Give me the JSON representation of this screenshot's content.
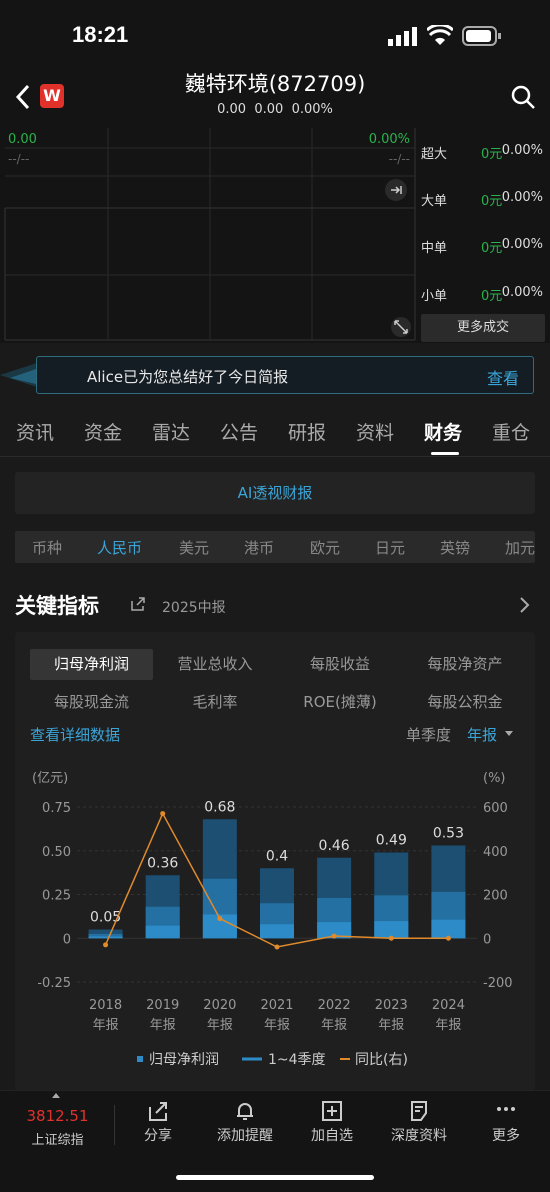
{
  "status": {
    "time": "18:21"
  },
  "header": {
    "title": "巍特环境(872709)",
    "sub1": "0.00",
    "sub2": "0.00",
    "sub3": "0.00%",
    "logo": "W"
  },
  "mini": {
    "left_val": "0.00",
    "right_val": "0.00%",
    "left_dash": "--/--",
    "right_dash": "--/--"
  },
  "flows": [
    {
      "label": "超大",
      "amt": "0元",
      "pct": "0.00%"
    },
    {
      "label": "大单",
      "amt": "0元",
      "pct": "0.00%"
    },
    {
      "label": "中单",
      "amt": "0元",
      "pct": "0.00%"
    },
    {
      "label": "小单",
      "amt": "0元",
      "pct": "0.00%"
    }
  ],
  "more_deals": "更多成交",
  "banner": {
    "text": "Alice已为您总结好了今日简报",
    "action": "查看"
  },
  "tabs": [
    "资讯",
    "资金",
    "雷达",
    "公告",
    "研报",
    "资料",
    "财务",
    "重仓"
  ],
  "ai_button": "AI透视财报",
  "currencies": [
    "币种",
    "人民币",
    "美元",
    "港币",
    "欧元",
    "日元",
    "英镑",
    "加元"
  ],
  "section": {
    "title": "关键指标",
    "period": "2025中报"
  },
  "metrics": [
    "归母净利润",
    "营业总收入",
    "每股收益",
    "每股净资产",
    "每股现金流",
    "毛利率",
    "ROE(摊薄)",
    "每股公积金"
  ],
  "detail_link": "查看详细数据",
  "period_opts": {
    "single": "单季度",
    "annual": "年报"
  },
  "chart_data": {
    "type": "bar",
    "ylabel_left": "(亿元)",
    "ylabel_right": "(%)",
    "categories": [
      "2018\n年报",
      "2019\n年报",
      "2020\n年报",
      "2021\n年报",
      "2022\n年报",
      "2023\n年报",
      "2024\n年报"
    ],
    "cat_year": [
      "2018",
      "2019",
      "2020",
      "2021",
      "2022",
      "2023",
      "2024"
    ],
    "cat_sub": "年报",
    "values": [
      0.05,
      0.36,
      0.68,
      0.4,
      0.46,
      0.49,
      0.53
    ],
    "labels": [
      "0.05",
      "0.36",
      "0.68",
      "0.4",
      "0.46",
      "0.49",
      "0.53"
    ],
    "yoy": [
      -30,
      570,
      90,
      -40,
      10,
      0,
      0
    ],
    "ylim_left": [
      -0.25,
      0.75
    ],
    "ylim_right": [
      -200,
      600
    ],
    "yticks_left": [
      "0.75",
      "0.50",
      "0.25",
      "0",
      "-0.25"
    ],
    "yticks_right": [
      "600",
      "400",
      "200",
      "0",
      "-200"
    ],
    "legend": [
      "归母净利润",
      "1~4季度",
      "同比(右)"
    ],
    "colors": {
      "bar": "#2d7fb8",
      "yoy": "#e08a2c"
    }
  },
  "bottom": {
    "index_val": "3812.51",
    "index_name": "上证综指",
    "items": [
      "分享",
      "添加提醒",
      "加自选",
      "深度资料",
      "更多"
    ]
  }
}
